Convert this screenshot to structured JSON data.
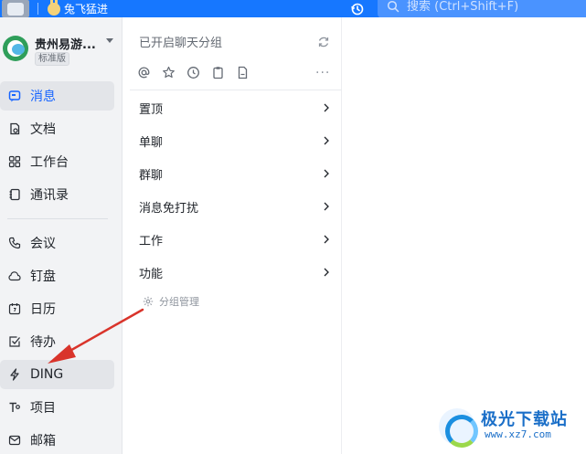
{
  "topbar": {
    "user_name": "兔飞猛进",
    "search_placeholder": "搜索 (Ctrl+Shift+F)",
    "accent": "#1677ff"
  },
  "sidebar": {
    "org_name": "贵州易游...",
    "org_badge": "标准版",
    "items": [
      {
        "label": "消息",
        "icon": "message-icon",
        "active": true
      },
      {
        "label": "文档",
        "icon": "document-icon"
      },
      {
        "label": "工作台",
        "icon": "workbench-icon"
      },
      {
        "label": "通讯录",
        "icon": "contacts-icon"
      },
      {
        "label": "会议",
        "icon": "phone-icon"
      },
      {
        "label": "钉盘",
        "icon": "cloud-icon"
      },
      {
        "label": "日历",
        "icon": "calendar-icon"
      },
      {
        "label": "待办",
        "icon": "todo-icon"
      },
      {
        "label": "DING",
        "icon": "lightning-icon",
        "highlighted": true
      },
      {
        "label": "项目",
        "icon": "project-icon"
      },
      {
        "label": "邮箱",
        "icon": "mail-icon"
      }
    ]
  },
  "middle": {
    "header": "已开启聊天分组",
    "tool_icons": [
      "at-icon",
      "star-icon",
      "clock-icon",
      "clipboard-icon",
      "file-icon"
    ],
    "more_label": "···",
    "groups": [
      "置顶",
      "单聊",
      "群聊",
      "消息免打扰",
      "工作",
      "功能"
    ],
    "manage_label": "分组管理"
  },
  "watermark": {
    "title": "极光下载站",
    "url": "www.xz7.com"
  },
  "annotation": {
    "color": "#d9342b"
  }
}
